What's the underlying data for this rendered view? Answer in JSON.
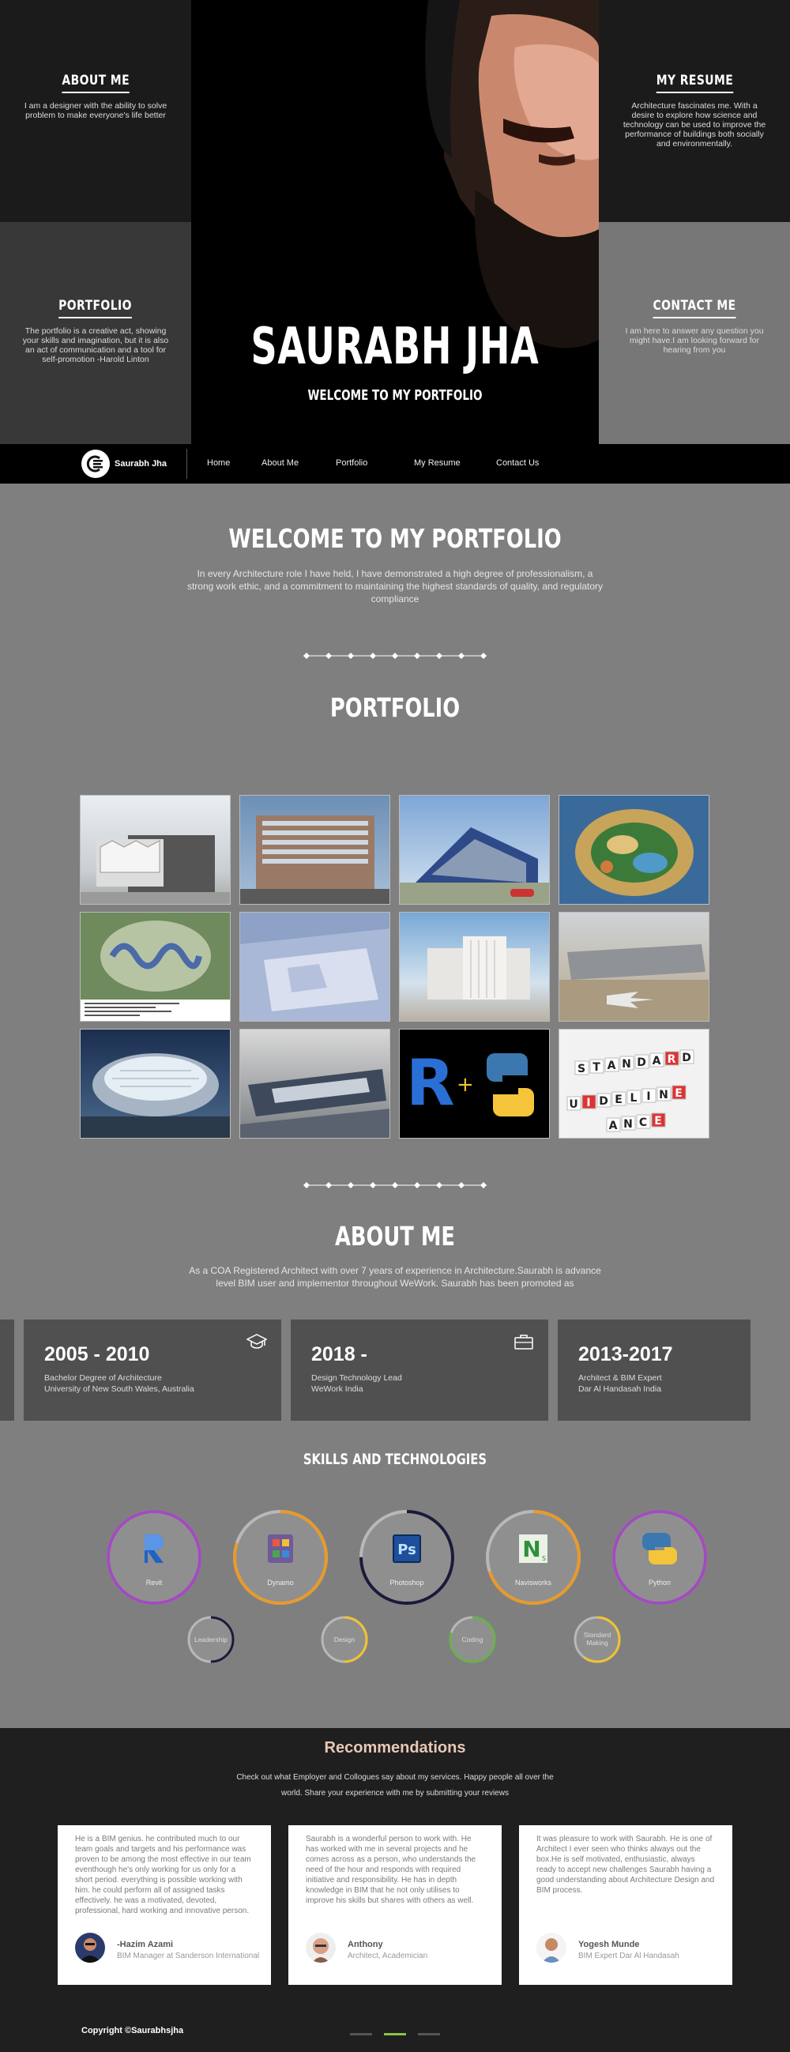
{
  "hero": {
    "about": {
      "title": "ABOUT ME",
      "text": "I am a designer with the ability to solve problem to make everyone's life better"
    },
    "portfolio": {
      "title": "PORTFOLIO",
      "text": "The portfolio is a creative act, showing your skills and imagination, but it is also an act of communication and a tool for self-promotion -Harold Linton"
    },
    "resume": {
      "title": "MY RESUME",
      "text": "Architecture fascinates me. With a desire to explore how science and technology can be used to improve the performance of buildings both socially and environmentally."
    },
    "contact": {
      "title": "CONTACT ME",
      "text": "I am here to answer any question you might have.I am looking forward for hearing from you"
    },
    "name": "SAURABH JHA",
    "subtitle": "WELCOME TO MY PORTFOLIO"
  },
  "nav": {
    "brand": "Saurabh Jha",
    "links": [
      "Home",
      "About Me",
      "Portfolio",
      "My Resume",
      "Contact Us"
    ]
  },
  "welcome": {
    "title": "WELCOME TO MY PORTFOLIO",
    "text": "In every Architecture  role I have held, I have demonstrated a high degree of professionalism, a strong work ethic, and a commitment to maintaining the highest standards of quality, and regulatory compliance"
  },
  "portfolio": {
    "title": "PORTFOLIO"
  },
  "about": {
    "title": "ABOUT ME",
    "text": "As a COA Registered Architect with over 7 years of experience in Architecture.Saurabh is advance level BIM user and implementor throughout WeWork. Saurabh has been promoted as",
    "cards": [
      {
        "year": "2005 - 2010",
        "line1": "Bachelor Degree of Architecture",
        "line2": "University of New South Wales, Australia",
        "icon": "graduation-cap-icon"
      },
      {
        "year": "2018 -",
        "line1": "Design Technology Lead",
        "line2": "WeWork India",
        "icon": "briefcase-icon"
      },
      {
        "year": "2013-2017",
        "line1": "Architect & BIM Expert",
        "line2": "Dar Al Handasah India",
        "icon": ""
      }
    ]
  },
  "skills": {
    "title": "SKILLS AND TECHNOLOGIES",
    "primary": [
      {
        "label": "Revit",
        "level": 1.0,
        "color": "#a24bbf"
      },
      {
        "label": "Dynamo",
        "level": 0.8,
        "color": "#e89a2a"
      },
      {
        "label": "Photoshop",
        "level": 0.75,
        "color": "#1a1a3a"
      },
      {
        "label": "Navisworks",
        "level": 0.7,
        "color": "#e89a2a"
      },
      {
        "label": "Python",
        "level": 1.0,
        "color": "#a24bbf"
      }
    ],
    "secondary": [
      {
        "label": "Leadership",
        "level": 0.5,
        "color": "#1a1a3a"
      },
      {
        "label": "Design",
        "level": 0.5,
        "color": "#f1c232"
      },
      {
        "label": "Coding",
        "level": 0.8,
        "color": "#6ab04c"
      },
      {
        "label": "Standard Making",
        "level": 0.6,
        "color": "#f1c232"
      }
    ]
  },
  "recommendations": {
    "title": "Recommendations",
    "subtitle": "Check out what Employer and Collogues  say about my services. Happy people all over the world. Share your experience with me by submitting your reviews",
    "items": [
      {
        "text": "He is a BIM genius. he contributed much to our team goals and targets and his performance was proven to be among the most effective in our team eventhough he's only working for us only for a short period. everything is possible working with him. he could perform all of assigned tasks effectively. he was a motivated, devoted, professional, hard working and innovative person.",
        "name": "-Hazim Azami",
        "role": "BIM Manager at Sanderson International"
      },
      {
        "text": "Saurabh is a wonderful person to work with. He has worked with me in several projects and he comes across as a person, who understands the need of the hour and responds with required initiative and responsibility. He has in depth knowledge in BIM that he not only utilises to improve his skills but shares with others as well.",
        "name": "Anthony",
        "role": "Architect, Academician"
      },
      {
        "text": "It was pleasure to work with Saurabh. He is one of Architect I ever seen who thinks always out the box.He is self motivated, enthusiastic, always ready to accept new challenges Saurabh having a good understanding about Architecture Design and BIM process.",
        "name": "Yogesh Munde",
        "role": "BIM Expert Dar Al Handasah"
      }
    ]
  },
  "footer": {
    "copyright": "Copyright ©Saurabhsjha"
  }
}
